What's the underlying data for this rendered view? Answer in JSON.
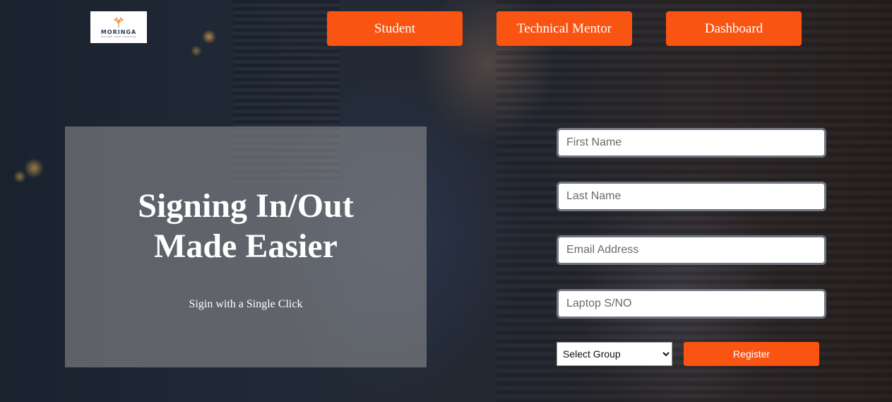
{
  "logo": {
    "text": "MORINGA",
    "subtext": "DISCOVER · GROW · TRANSFORM"
  },
  "nav": {
    "student": "Student",
    "technical_mentor": "Technical Mentor",
    "dashboard": "Dashboard"
  },
  "hero": {
    "title_line1": "Signing In/Out",
    "title_line2": "Made Easier",
    "subtitle": "Sigin with a Single Click"
  },
  "form": {
    "first_name_placeholder": "First Name",
    "last_name_placeholder": "Last Name",
    "email_placeholder": "Email Address",
    "laptop_placeholder": "Laptop S/NO",
    "group_selected": "Select Group",
    "register_label": "Register"
  },
  "colors": {
    "accent": "#fa5412",
    "panel": "rgba(150,150,150,0.55)",
    "logo_text": "#2b3a5c"
  }
}
